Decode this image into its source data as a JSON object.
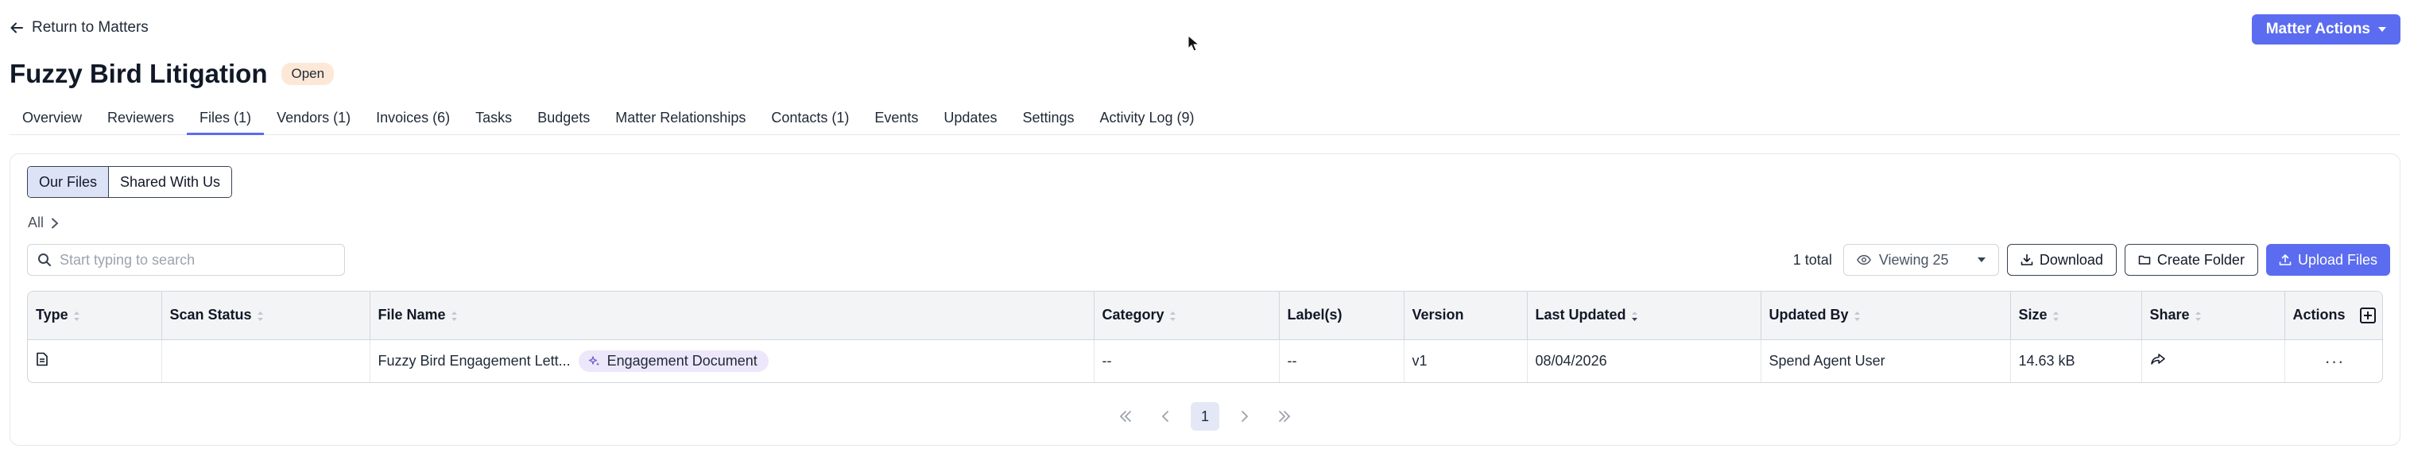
{
  "header": {
    "back_label": "Return to Matters",
    "title": "Fuzzy Bird Litigation",
    "status": "Open",
    "matter_actions_label": "Matter Actions"
  },
  "tabs": [
    {
      "label": "Overview"
    },
    {
      "label": "Reviewers"
    },
    {
      "label": "Files (1)",
      "active": true
    },
    {
      "label": "Vendors (1)"
    },
    {
      "label": "Invoices (6)"
    },
    {
      "label": "Tasks"
    },
    {
      "label": "Budgets"
    },
    {
      "label": "Matter Relationships"
    },
    {
      "label": "Contacts (1)"
    },
    {
      "label": "Events"
    },
    {
      "label": "Updates"
    },
    {
      "label": "Settings"
    },
    {
      "label": "Activity Log (9)"
    }
  ],
  "files": {
    "segments": {
      "our_files": "Our Files",
      "shared_with_us": "Shared With Us"
    },
    "breadcrumb": "All",
    "search_placeholder": "Start typing to search",
    "total_label": "1 total",
    "viewing_label": "Viewing 25",
    "download_label": "Download",
    "create_folder_label": "Create Folder",
    "upload_label": "Upload Files",
    "columns": [
      "Type",
      "Scan Status",
      "File Name",
      "Category",
      "Label(s)",
      "Version",
      "Last Updated",
      "Updated By",
      "Size",
      "Share",
      "Actions"
    ],
    "rows": [
      {
        "type_icon": "document-icon",
        "scan_status": "",
        "file_name": "Fuzzy Bird Engagement Lett...",
        "category_chip": "Engagement Document",
        "category": "--",
        "labels": "--",
        "version": "v1",
        "last_updated": "08/04/2026",
        "updated_by": "Spend Agent User",
        "size": "14.63 kB",
        "actions": "···"
      }
    ],
    "pagination": {
      "current_page": "1"
    }
  },
  "colors": {
    "primary": "#5b6cf0",
    "status_badge_bg": "#fde8d7",
    "chip_bg": "#ede7fb",
    "header_bg": "#f3f4f6"
  }
}
